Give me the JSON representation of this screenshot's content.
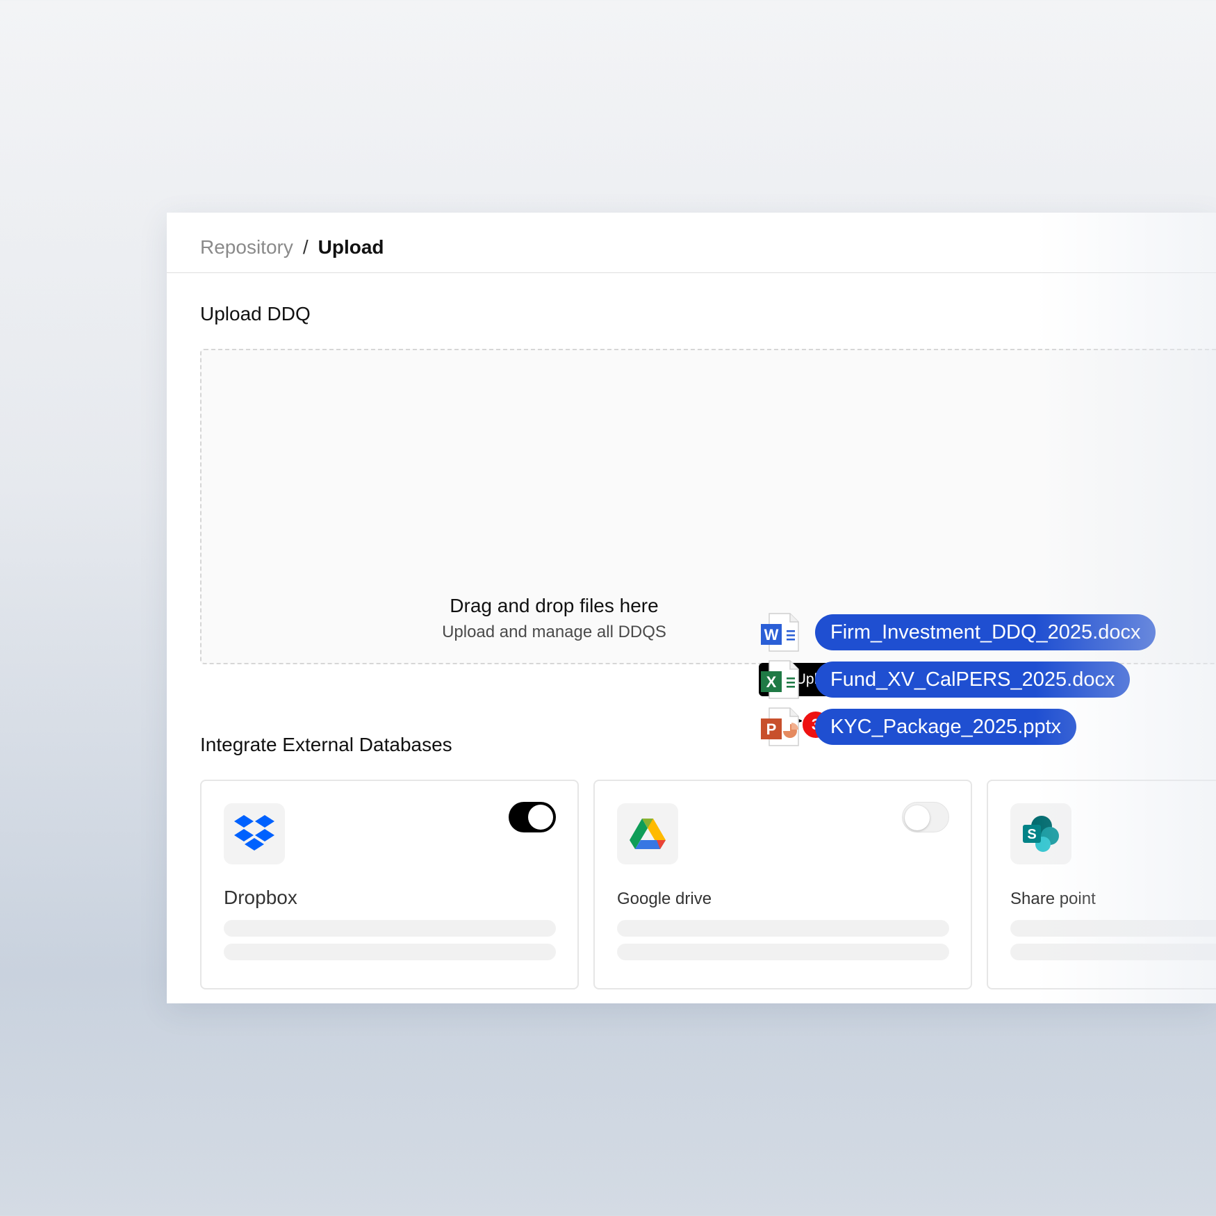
{
  "breadcrumb": {
    "parent": "Repository",
    "separator": "/",
    "current": "Upload"
  },
  "upload_section": {
    "title": "Upload DDQ",
    "dropzone_title": "Drag and drop files here",
    "dropzone_subtitle": "Upload and manage all DDQS",
    "upload_button_label": "Upload",
    "upload_icon": "upload-icon"
  },
  "drag_badge_count": "3",
  "dragged_files": [
    {
      "name": "Firm_Investment_DDQ_2025.docx",
      "type": "word",
      "letter": "W",
      "color": "#2b5fd6"
    },
    {
      "name": "Fund_XV_CalPERS_2025.docx",
      "type": "excel",
      "letter": "X",
      "color": "#1f7a45"
    },
    {
      "name": "KYC_Package_2025.pptx",
      "type": "powerpoint",
      "letter": "P",
      "color": "#c8502c"
    }
  ],
  "integrations_section": {
    "title": "Integrate External Databases",
    "items": [
      {
        "name": "Dropbox",
        "icon": "dropbox-icon",
        "enabled": true
      },
      {
        "name": "Google drive",
        "icon": "google-drive-icon",
        "enabled": false
      },
      {
        "name": "Share point",
        "icon": "sharepoint-icon"
      }
    ]
  },
  "colors": {
    "chip_blue": "#1f4fd1",
    "badge_red": "#e11111",
    "button_black": "#000000",
    "dropbox_blue": "#0061fe"
  }
}
